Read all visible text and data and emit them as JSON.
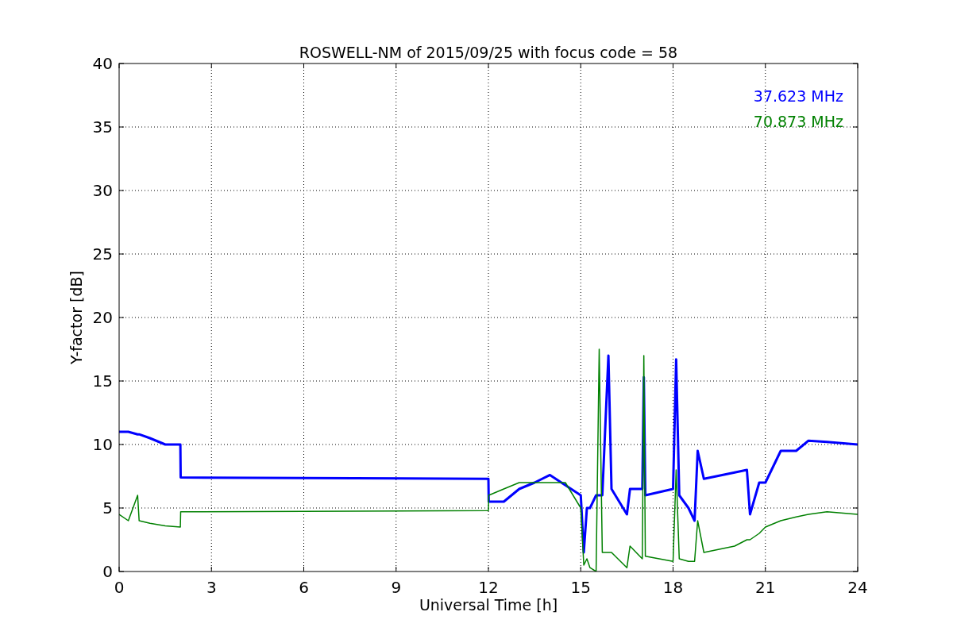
{
  "figure": {
    "chart_data": {
      "type": "line",
      "title": "ROSWELL-NM of 2015/09/25 with focus code = 58",
      "xlabel": "Universal Time [h]",
      "ylabel": "Y-factor [dB]",
      "x": [
        0,
        0.3,
        0.6,
        0.65,
        1,
        1.5,
        1.99,
        2,
        12,
        12.01,
        12.5,
        13,
        13.5,
        14,
        14.5,
        15,
        15.1,
        15.2,
        15.3,
        15.5,
        15.6,
        15.7,
        15.9,
        16,
        16.5,
        16.6,
        17,
        17.05,
        17.1,
        18,
        18.1,
        18.2,
        18.5,
        18.7,
        18.8,
        19,
        20,
        20.4,
        20.5,
        20.8,
        21,
        21.5,
        22,
        22.4,
        23,
        24
      ],
      "series": [
        {
          "name": "37.623 MHz",
          "color": "#0000ff",
          "values": [
            11,
            11,
            10.8,
            10.8,
            10.5,
            10,
            10,
            7.4,
            7.3,
            5.5,
            5.5,
            6.5,
            7,
            7.6,
            6.8,
            6,
            1.5,
            5,
            5,
            6,
            6,
            6,
            17,
            6.5,
            4.5,
            6.5,
            6.5,
            15.3,
            6,
            6.5,
            16.7,
            6,
            5,
            4,
            9.5,
            7.3,
            7.8,
            8,
            4.5,
            7,
            7,
            9.5,
            9.5,
            10.3,
            10.2,
            10
          ]
        },
        {
          "name": "70.873 MHz",
          "color": "#008000",
          "values": [
            4.5,
            4,
            6,
            4,
            3.8,
            3.6,
            3.5,
            4.7,
            4.8,
            6,
            6.5,
            7,
            7,
            7,
            7,
            5,
            0.5,
            1,
            0.3,
            0,
            17.5,
            1.5,
            1.5,
            1.5,
            0.3,
            2,
            1,
            17,
            1.2,
            0.8,
            8,
            1,
            0.8,
            0.8,
            4,
            1.5,
            2,
            2.5,
            2.5,
            3,
            3.5,
            4,
            4.3,
            4.5,
            4.7,
            4.5
          ]
        }
      ],
      "grid": true,
      "xlim": [
        0,
        24
      ],
      "ylim": [
        0,
        40
      ],
      "xticks": [
        0,
        3,
        6,
        9,
        12,
        15,
        18,
        21,
        24
      ],
      "yticks": [
        0,
        5,
        10,
        15,
        20,
        25,
        30,
        35,
        40
      ]
    }
  }
}
